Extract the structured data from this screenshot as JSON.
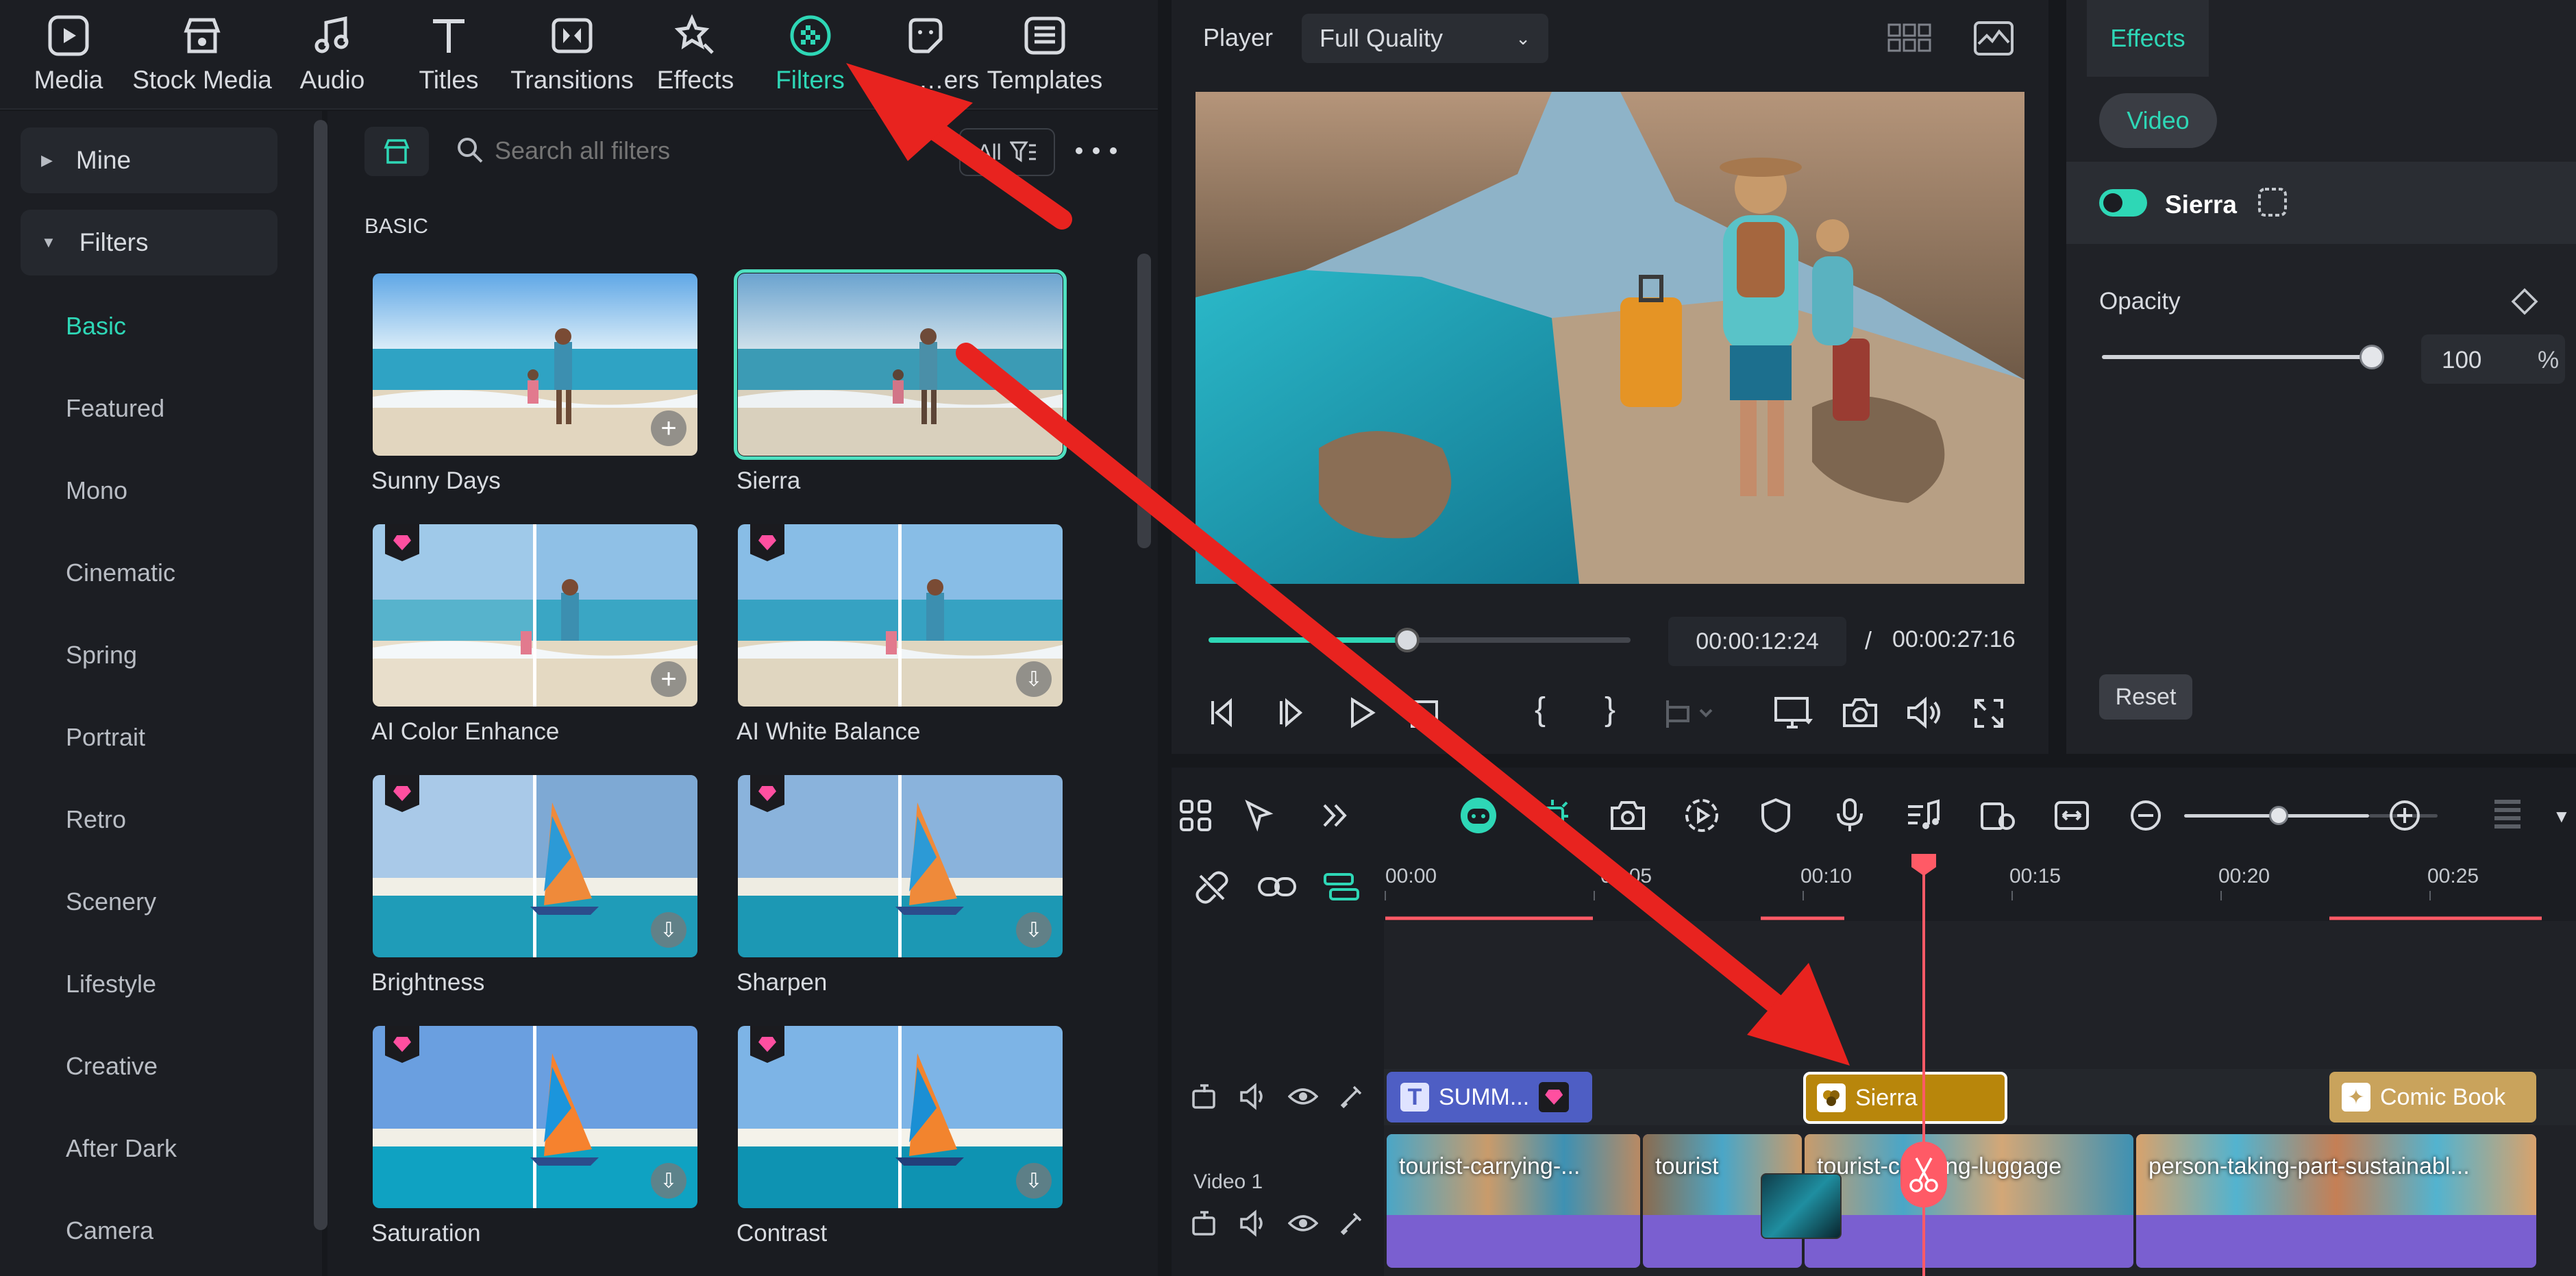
{
  "nav": {
    "tabs": [
      {
        "label": "Media",
        "icon": "media-icon"
      },
      {
        "label": "Stock Media",
        "icon": "stock-media-icon"
      },
      {
        "label": "Audio",
        "icon": "audio-icon"
      },
      {
        "label": "Titles",
        "icon": "titles-icon"
      },
      {
        "label": "Transitions",
        "icon": "transitions-icon"
      },
      {
        "label": "Effects",
        "icon": "effects-icon"
      },
      {
        "label": "Filters",
        "icon": "filters-icon",
        "active": true
      },
      {
        "label": "…ers",
        "icon": "stickers-icon"
      },
      {
        "label": "Templates",
        "icon": "templates-icon"
      }
    ]
  },
  "sidebar": {
    "groups": [
      {
        "label": "Mine"
      },
      {
        "label": "Filters"
      }
    ],
    "categories": [
      "Basic",
      "Featured",
      "Mono",
      "Cinematic",
      "Spring",
      "Portrait",
      "Retro",
      "Scenery",
      "Lifestyle",
      "Creative",
      "After Dark",
      "Camera"
    ],
    "active_category": "Basic"
  },
  "filters_panel": {
    "search_placeholder": "Search all filters",
    "filter_chip": "All",
    "section_title": "BASIC",
    "items": [
      {
        "label": "Sunny Days",
        "premium": false,
        "action": "add"
      },
      {
        "label": "Sierra",
        "premium": false,
        "selected": true
      },
      {
        "label": "AI Color Enhance",
        "premium": true,
        "action": "add"
      },
      {
        "label": "AI White Balance",
        "premium": true,
        "action": "download"
      },
      {
        "label": "Brightness",
        "premium": true,
        "action": "download"
      },
      {
        "label": "Sharpen",
        "premium": true,
        "action": "download"
      },
      {
        "label": "Saturation",
        "premium": true,
        "action": "download"
      },
      {
        "label": "Contrast",
        "premium": true,
        "action": "download"
      }
    ]
  },
  "player": {
    "label": "Player",
    "quality": "Full Quality",
    "current_time": "00:00:12:24",
    "separator": "/",
    "total_time": "00:00:27:16",
    "progress": 0.47
  },
  "effects_panel": {
    "tab": "Effects",
    "subtab": "Video",
    "effect_name": "Sierra",
    "opacity_label": "Opacity",
    "opacity_value": "100",
    "opacity_unit": "%",
    "reset_label": "Reset"
  },
  "timeline": {
    "ruler": [
      "00:00",
      "00:05",
      "00:10",
      "00:15",
      "00:20",
      "00:25"
    ],
    "track_label": "Video 1",
    "title_clip": "SUMM...",
    "filter_clip": "Sierra",
    "effect_clip": "Comic Book",
    "video_clips": [
      "tourist-carrying-...",
      "tourist",
      "tourist-carrying-luggage",
      "person-taking-part-sustainabl..."
    ]
  },
  "colors": {
    "accent": "#2ed7b6",
    "playhead": "#ff5a66",
    "arrow": "#e8231f",
    "filter_clip": "#b8860b",
    "effect_clip": "#c9a35c",
    "video_clip": "#7a5fd0"
  }
}
